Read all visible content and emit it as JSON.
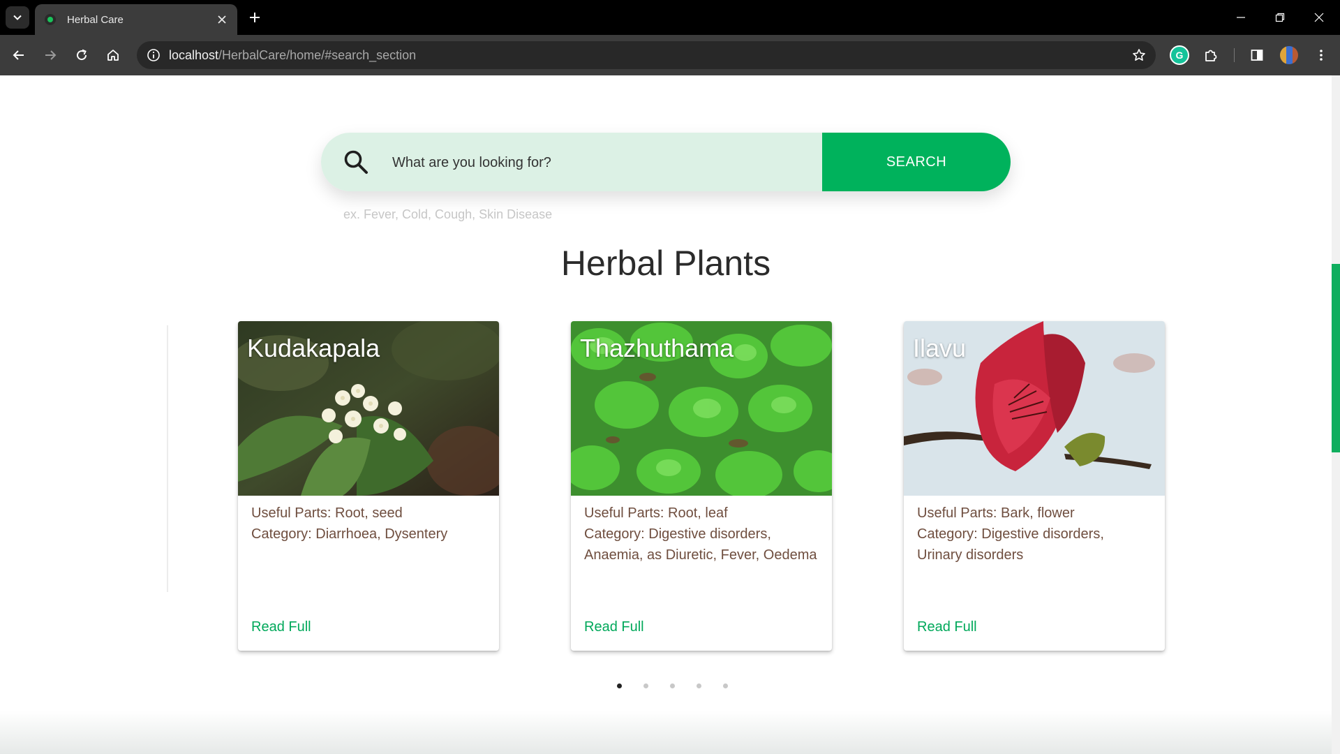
{
  "browser": {
    "tab_title": "Herbal Care",
    "url_host": "localhost",
    "url_path": "/HerbalCare/home/#search_section"
  },
  "search": {
    "placeholder": "What are you looking for?",
    "button_label": "SEARCH",
    "hint": "ex. Fever, Cold, Cough, Skin Disease"
  },
  "section": {
    "title": "Herbal Plants"
  },
  "cards": [
    {
      "name": "Kudakapala",
      "useful_parts": "Useful Parts: Root, seed",
      "category": "Category: Diarrhoea, Dysentery",
      "link_label": "Read Full"
    },
    {
      "name": "Thazhuthama",
      "useful_parts": "Useful Parts: Root, leaf",
      "category": "Category: Digestive disorders, Anaemia, as Diuretic, Fever, Oedema",
      "link_label": "Read Full"
    },
    {
      "name": "Ilavu",
      "useful_parts": "Useful Parts: Bark, flower",
      "category": "Category: Digestive disorders, Urinary disorders",
      "link_label": "Read Full"
    }
  ],
  "carousel": {
    "page_count": 5,
    "active_page": 1
  },
  "colors": {
    "brand_green": "#00b25c",
    "search_field_bg": "#dcf1e5",
    "card_text": "#6f4e3f",
    "link_green": "#00a85a"
  },
  "icons": {
    "search": "magnifier-icon",
    "tab_close": "close-icon",
    "bookmark": "star-icon"
  }
}
